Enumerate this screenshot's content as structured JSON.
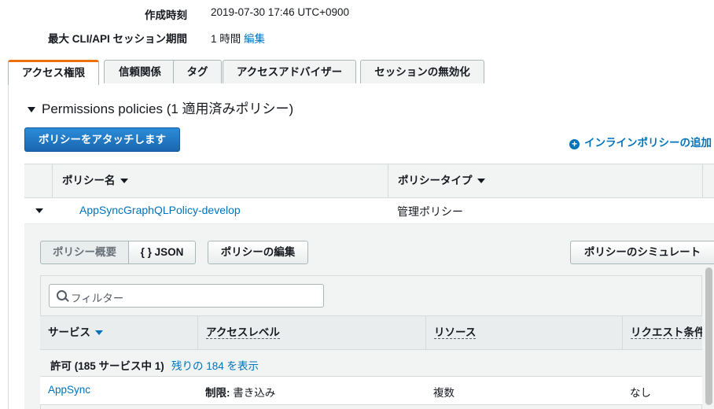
{
  "summary": {
    "created_label": "作成時刻",
    "created_value": "2019-07-30 17:46 UTC+0900",
    "session_label": "最大 CLI/API セッション期間",
    "session_value": "1 時間",
    "session_edit": "編集"
  },
  "tabs": [
    {
      "label": "アクセス権限",
      "active": true
    },
    {
      "label": "信頼関係",
      "active": false
    },
    {
      "label": "タグ",
      "active": false
    },
    {
      "label": "アクセスアドバイザー",
      "active": false
    },
    {
      "label": "セッションの無効化",
      "active": false
    }
  ],
  "permissions": {
    "section_title": "Permissions policies (1 適用済みポリシー)",
    "attach_button": "ポリシーをアタッチします",
    "inline_link": "インラインポリシーの追加",
    "columns": [
      "ポリシー名",
      "ポリシータイプ"
    ],
    "policy_name": "AppSyncGraphQLPolicy-develop",
    "policy_type": "管理ポリシー"
  },
  "detail": {
    "seg_summary": "ポリシー概要",
    "seg_json": "{ } JSON",
    "edit_button": "ポリシーの編集",
    "simulate_button": "ポリシーのシミュレート",
    "filter_placeholder": "フィルター",
    "columns": [
      "サービス",
      "アクセスレベル",
      "リソース",
      "リクエスト条件"
    ],
    "allowed_text": "許可 (185 サービス中 1)",
    "allowed_link": "残りの 184 を表示",
    "row": {
      "service": "AppSync",
      "access_prefix": "制限:",
      "access_value": "書き込み",
      "resource": "複数",
      "condition": "なし"
    }
  },
  "colors": {
    "accent": "#ec7211",
    "link": "#0073bb",
    "primary": "#1a66b0"
  }
}
